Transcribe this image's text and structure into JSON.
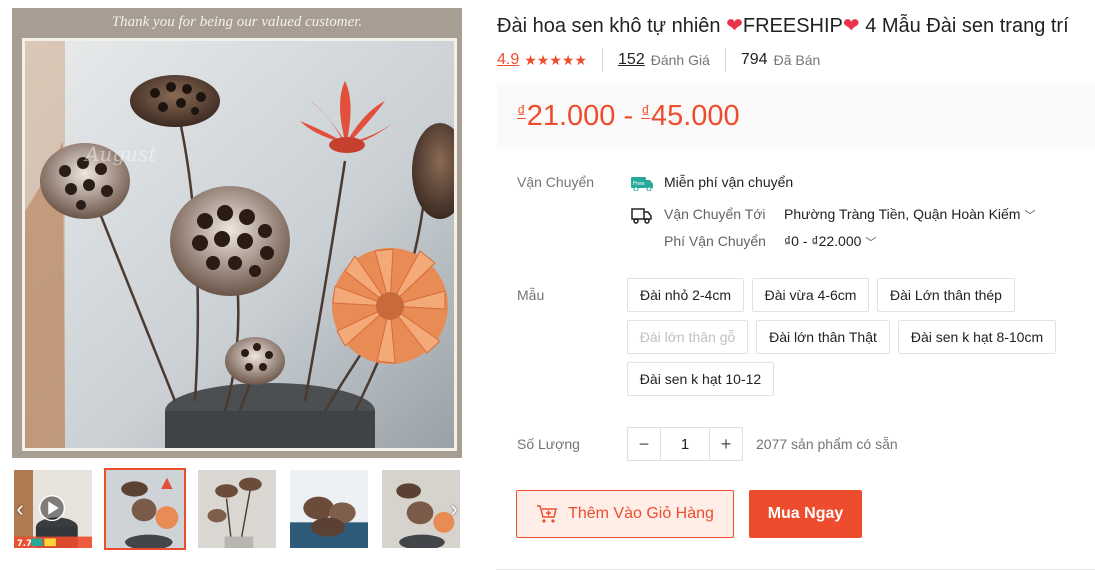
{
  "gallery": {
    "banner_text": "Thank you for being our valued customer.",
    "watermark": "August",
    "thumbnails": [
      {
        "name": "video",
        "badge_text": "7.7",
        "active": false
      },
      {
        "name": "lotus-bouquet",
        "active": true
      },
      {
        "name": "lotus-pods-vase",
        "active": false
      },
      {
        "name": "lotus-pods-pile",
        "active": false
      },
      {
        "name": "lotus-pods-dark",
        "active": false
      }
    ],
    "nav_prev": "‹",
    "nav_next": "›"
  },
  "product": {
    "title_part1": "Đài hoa sen khô tự nhiên ",
    "title_heart": "❤",
    "title_part2": "FREESHIP",
    "title_part3": " 4 Mẫu Đài sen trang trí",
    "rating": "4.9",
    "stars": "★★★★★",
    "reviews_count": "152",
    "reviews_label": "Đánh Giá",
    "sold_count": "794",
    "sold_label": "Đã Bán",
    "price_currency": "₫",
    "price_min": "21.000",
    "price_sep": " - ",
    "price_max": "45.000"
  },
  "shipping": {
    "label": "Vận Chuyển",
    "free_text": "Miễn phí vận chuyển",
    "free_icon_text": "Free",
    "ship_to_label": "Vận Chuyển Tới",
    "ship_to_value": "Phường Tràng Tiền, Quận Hoàn Kiếm",
    "fee_label": "Phí Vận Chuyển",
    "fee_value": "₫0 - ₫22.000"
  },
  "variants": {
    "label": "Mẫu",
    "options": [
      {
        "label": "Đài nhỏ 2-4cm",
        "disabled": false
      },
      {
        "label": "Đài vừa 4-6cm",
        "disabled": false
      },
      {
        "label": "Đài Lớn thân thép",
        "disabled": false
      },
      {
        "label": "Đài lớn thân gỗ",
        "disabled": true
      },
      {
        "label": "Đài lớn thân Thật",
        "disabled": false
      },
      {
        "label": "Đài sen k hạt 8-10cm",
        "disabled": false
      },
      {
        "label": "Đài sen k hạt 10-12",
        "disabled": false
      }
    ]
  },
  "quantity": {
    "label": "Số Lượng",
    "minus": "−",
    "value": "1",
    "plus": "+",
    "stock_text": "2077 sản phẩm có sẵn"
  },
  "actions": {
    "add_to_cart": "Thêm Vào Giỏ Hàng",
    "buy_now": "Mua Ngay"
  },
  "colors": {
    "accent": "#ee4d2d",
    "accent_light": "#ffeee8",
    "free_ship": "#26aa99"
  }
}
